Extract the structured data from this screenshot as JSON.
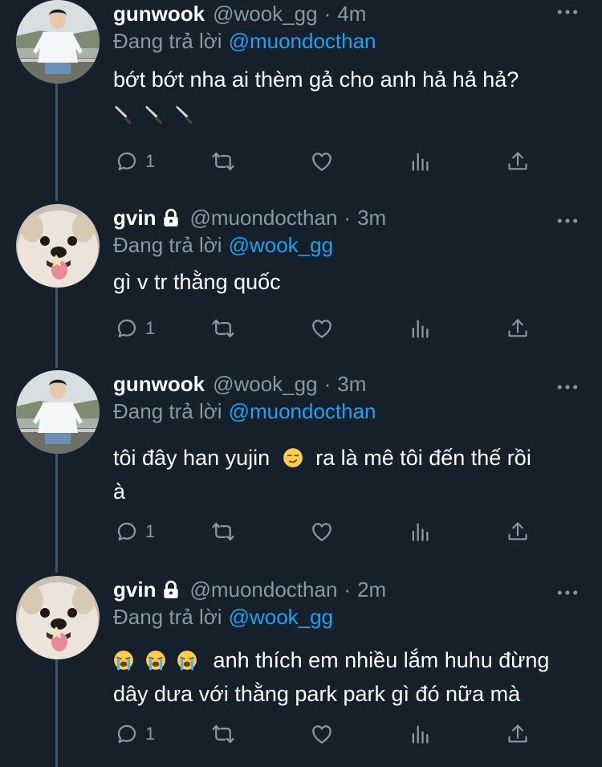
{
  "tweets": [
    {
      "name": "gunwook",
      "handle": "@wook_gg",
      "time": "4m",
      "reply_label": "Đang trả lời",
      "reply_to": "@muondocthan",
      "text": "bớt bớt nha ai thèm gả cho anh hả hả hả?",
      "emojis": "🔪🔪🔪",
      "reply_count": "1",
      "locked": false
    },
    {
      "name": "gvin",
      "handle": "@muondocthan",
      "time": "3m",
      "reply_label": "Đang trả lời",
      "reply_to": "@wook_gg",
      "text": "gì v tr thằng quốc",
      "reply_count": "1",
      "locked": true
    },
    {
      "name": "gunwook",
      "handle": "@wook_gg",
      "time": "3m",
      "reply_label": "Đang trả lời",
      "reply_to": "@muondocthan",
      "text_before": "tôi đây han yujin",
      "text_after": "ra là mê tôi đến thế rồi",
      "text_line2": "à",
      "reply_count": "1",
      "locked": false
    },
    {
      "name": "gvin",
      "handle": "@muondocthan",
      "time": "2m",
      "reply_label": "Đang trả lời",
      "reply_to": "@wook_gg",
      "text_line1": "anh thích em nhiều lắm huhu đừng",
      "text_line2": "dây dưa với thằng park park gì đó nữa mà",
      "reply_count": "1",
      "locked": true
    }
  ],
  "separator": "·",
  "colors": {
    "background": "#15202b",
    "secondary_text": "#8899a6",
    "mention": "#1da1f2",
    "thread_line": "#3d5466"
  },
  "icons": [
    "reply-icon",
    "retweet-icon",
    "like-icon",
    "analytics-icon",
    "share-icon",
    "more-icon",
    "lock-icon"
  ]
}
